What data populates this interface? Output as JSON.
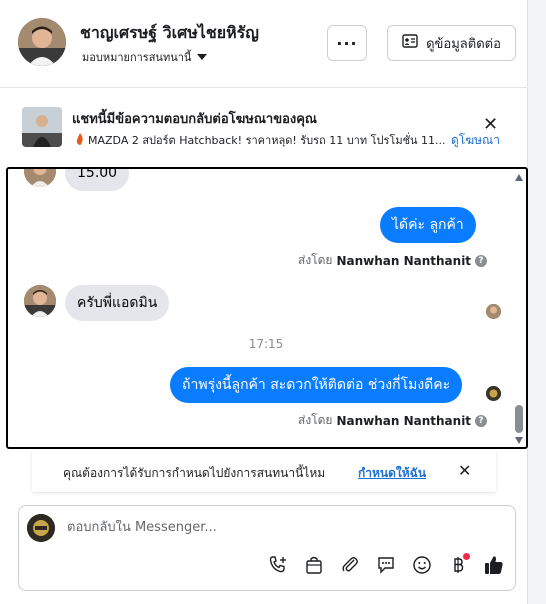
{
  "header": {
    "name": "ชาญเศรษฐ์ วิเศษไชยหิรัญ",
    "assign_label": "มอบหมายการสนทนานี้",
    "more_label": "···",
    "contact_label": "ดูข้อมูลติดต่อ"
  },
  "ad": {
    "title": "แชทนี้มีข้อความตอบกลับต่อโฆษณาของคุณ",
    "description": "MAZDA 2 สปอร์ต Hatchback! ราคาหลุด! รับรถ 11 บาท โปรโมชั่น 11...",
    "link": "ดูโฆษณา",
    "close": "✕"
  },
  "chat": {
    "messages": [
      {
        "text": "15.00"
      },
      {
        "text": "ได้ค่ะ  ลูกค้า"
      },
      {
        "text": "ครับพี่แอดมิน"
      },
      {
        "text": "ถ้าพรุ่งนี้ลูกค้า  สะดวกให้ติดต่อ ช่วงกี่โมงดีคะ"
      }
    ],
    "sent_by_prefix": "ส่งโดย",
    "sender": "Nanwhan Nanthanit",
    "timestamp": "17:15"
  },
  "assign_prompt": {
    "text": "คุณต้องการได้รับการกำหนดไปยังการสนทนานี้ไหม",
    "link": "กำหนดให้ฉัน",
    "close": "✕"
  },
  "composer": {
    "placeholder": "ตอบกลับใน Messenger..."
  },
  "tools": [
    "phone-add-icon",
    "bag-icon",
    "paperclip-icon",
    "chat-bubble-icon",
    "emoji-icon",
    "baht-icon",
    "thumbs-up-icon"
  ],
  "colors": {
    "accent": "#0a7cff",
    "link": "#1f6fd1",
    "incoming_bubble": "#e4e6eb",
    "notification": "#f02849"
  }
}
